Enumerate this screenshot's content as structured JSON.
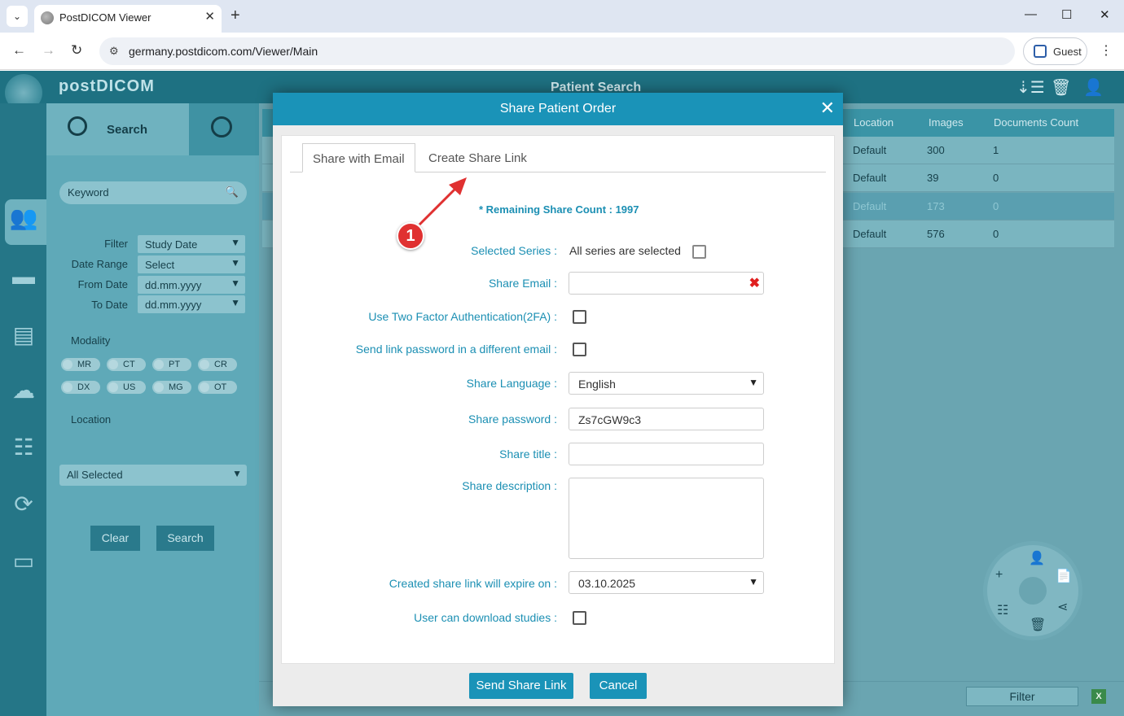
{
  "browser": {
    "tab_title": "PostDICOM Viewer",
    "url": "germany.postdicom.com/Viewer/Main",
    "profile": "Guest"
  },
  "app": {
    "logo": "postDICOM",
    "header_title": "Patient Search"
  },
  "search_panel": {
    "tab_search": "Search",
    "keyword_placeholder": "Keyword",
    "filters": [
      {
        "label": "Filter",
        "value": "Study Date"
      },
      {
        "label": "Date Range",
        "value": "Select"
      },
      {
        "label": "From Date",
        "value": "dd.mm.yyyy"
      },
      {
        "label": "To Date",
        "value": "dd.mm.yyyy"
      }
    ],
    "modality_label": "Modality",
    "modalities": [
      "MR",
      "CT",
      "PT",
      "CR",
      "DX",
      "US",
      "MG",
      "OT"
    ],
    "location_label": "Location",
    "location_value": "All Selected",
    "clear_label": "Clear",
    "search_label": "Search"
  },
  "grid": {
    "columns": [
      "Location",
      "Images",
      "Documents Count"
    ],
    "rows": [
      [
        "Default",
        "300",
        "1"
      ],
      [
        "Default",
        "39",
        "0"
      ],
      [
        "Default",
        "173",
        "0"
      ],
      [
        "Default",
        "576",
        "0"
      ]
    ],
    "filter_label": "Filter"
  },
  "modal": {
    "title": "Share Patient Order",
    "tabs": [
      "Share with Email",
      "Create Share Link"
    ],
    "remaining": "* Remaining Share Count : 1997",
    "selected_series_label": "Selected Series :",
    "selected_series_value": "All series are selected",
    "share_email_label": "Share Email :",
    "two_factor_label": "Use Two Factor Authentication(2FA) :",
    "send_pw_label": "Send link password in a different email :",
    "language_label": "Share Language :",
    "language_value": "English",
    "password_label": "Share password :",
    "password_value": "Zs7cGW9c3",
    "title_label": "Share title :",
    "description_label": "Share description :",
    "expire_label": "Created share link will expire on :",
    "expire_value": "03.10.2025",
    "download_label": "User can download studies :",
    "send_button": "Send Share Link",
    "cancel_button": "Cancel"
  },
  "annotation": {
    "number": "1",
    "color": "#e03131"
  }
}
